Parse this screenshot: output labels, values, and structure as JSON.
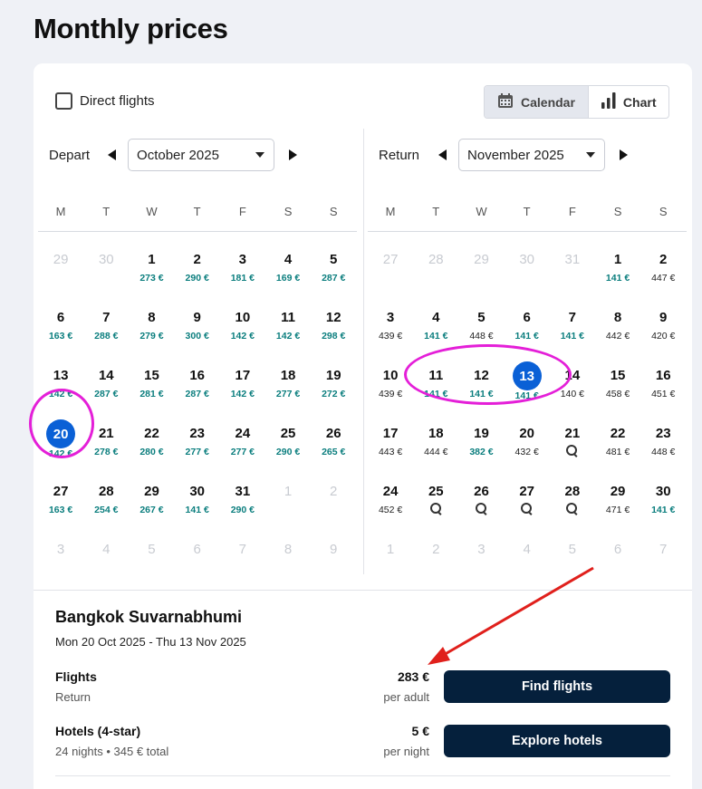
{
  "page_title": "Monthly prices",
  "filters": {
    "direct_flights_label": "Direct flights",
    "direct_flights_checked": false
  },
  "view_toggle": {
    "calendar_label": "Calendar",
    "chart_label": "Chart",
    "active": "Calendar"
  },
  "weekdays": [
    "M",
    "T",
    "W",
    "T",
    "F",
    "S",
    "S"
  ],
  "depart": {
    "label": "Depart",
    "month": "October 2025",
    "selected_day": "20",
    "days": [
      {
        "d": "29",
        "muted": true
      },
      {
        "d": "30",
        "muted": true
      },
      {
        "d": "1",
        "p": "273 €",
        "c": true
      },
      {
        "d": "2",
        "p": "290 €",
        "c": true
      },
      {
        "d": "3",
        "p": "181 €",
        "c": true
      },
      {
        "d": "4",
        "p": "169 €",
        "c": true
      },
      {
        "d": "5",
        "p": "287 €",
        "c": true
      },
      {
        "d": "6",
        "p": "163 €",
        "c": true
      },
      {
        "d": "7",
        "p": "288 €",
        "c": true
      },
      {
        "d": "8",
        "p": "279 €",
        "c": true
      },
      {
        "d": "9",
        "p": "300 €",
        "c": true
      },
      {
        "d": "10",
        "p": "142 €",
        "c": true
      },
      {
        "d": "11",
        "p": "142 €",
        "c": true
      },
      {
        "d": "12",
        "p": "298 €",
        "c": true
      },
      {
        "d": "13",
        "p": "142 €",
        "c": true
      },
      {
        "d": "14",
        "p": "287 €",
        "c": true
      },
      {
        "d": "15",
        "p": "281 €",
        "c": true
      },
      {
        "d": "16",
        "p": "287 €",
        "c": true
      },
      {
        "d": "17",
        "p": "142 €",
        "c": true
      },
      {
        "d": "18",
        "p": "277 €",
        "c": true
      },
      {
        "d": "19",
        "p": "272 €",
        "c": true
      },
      {
        "d": "20",
        "p": "142 €",
        "c": true,
        "sel": true
      },
      {
        "d": "21",
        "p": "278 €",
        "c": true
      },
      {
        "d": "22",
        "p": "280 €",
        "c": true
      },
      {
        "d": "23",
        "p": "277 €",
        "c": true
      },
      {
        "d": "24",
        "p": "277 €",
        "c": true
      },
      {
        "d": "25",
        "p": "290 €",
        "c": true
      },
      {
        "d": "26",
        "p": "265 €",
        "c": true
      },
      {
        "d": "27",
        "p": "163 €",
        "c": true
      },
      {
        "d": "28",
        "p": "254 €",
        "c": true
      },
      {
        "d": "29",
        "p": "267 €",
        "c": true
      },
      {
        "d": "30",
        "p": "141 €",
        "c": true
      },
      {
        "d": "31",
        "p": "290 €",
        "c": true
      },
      {
        "d": "1",
        "muted": true
      },
      {
        "d": "2",
        "muted": true
      },
      {
        "d": "3",
        "muted": true
      },
      {
        "d": "4",
        "muted": true
      },
      {
        "d": "5",
        "muted": true
      },
      {
        "d": "6",
        "muted": true
      },
      {
        "d": "7",
        "muted": true
      },
      {
        "d": "8",
        "muted": true
      },
      {
        "d": "9",
        "muted": true
      }
    ]
  },
  "return": {
    "label": "Return",
    "month": "November 2025",
    "selected_day": "13",
    "days": [
      {
        "d": "27",
        "muted": true
      },
      {
        "d": "28",
        "muted": true
      },
      {
        "d": "29",
        "muted": true
      },
      {
        "d": "30",
        "muted": true
      },
      {
        "d": "31",
        "muted": true
      },
      {
        "d": "1",
        "p": "141 €",
        "c": true
      },
      {
        "d": "2",
        "p": "447 €"
      },
      {
        "d": "3",
        "p": "439 €"
      },
      {
        "d": "4",
        "p": "141 €",
        "c": true
      },
      {
        "d": "5",
        "p": "448 €"
      },
      {
        "d": "6",
        "p": "141 €",
        "c": true
      },
      {
        "d": "7",
        "p": "141 €",
        "c": true
      },
      {
        "d": "8",
        "p": "442 €"
      },
      {
        "d": "9",
        "p": "420 €"
      },
      {
        "d": "10",
        "p": "439 €"
      },
      {
        "d": "11",
        "p": "141 €",
        "c": true
      },
      {
        "d": "12",
        "p": "141 €",
        "c": true
      },
      {
        "d": "13",
        "p": "141 €",
        "c": true,
        "sel": true
      },
      {
        "d": "14",
        "p": "140 €"
      },
      {
        "d": "15",
        "p": "458 €"
      },
      {
        "d": "16",
        "p": "451 €"
      },
      {
        "d": "17",
        "p": "443 €"
      },
      {
        "d": "18",
        "p": "444 €"
      },
      {
        "d": "19",
        "p": "382 €",
        "c": true
      },
      {
        "d": "20",
        "p": "432 €"
      },
      {
        "d": "21",
        "search": true
      },
      {
        "d": "22",
        "p": "481 €"
      },
      {
        "d": "23",
        "p": "448 €"
      },
      {
        "d": "24",
        "p": "452 €"
      },
      {
        "d": "25",
        "search": true
      },
      {
        "d": "26",
        "search": true
      },
      {
        "d": "27",
        "search": true
      },
      {
        "d": "28",
        "search": true
      },
      {
        "d": "29",
        "p": "471 €"
      },
      {
        "d": "30",
        "p": "141 €",
        "c": true
      },
      {
        "d": "1",
        "muted": true
      },
      {
        "d": "2",
        "muted": true
      },
      {
        "d": "3",
        "muted": true
      },
      {
        "d": "4",
        "muted": true
      },
      {
        "d": "5",
        "muted": true
      },
      {
        "d": "6",
        "muted": true
      },
      {
        "d": "7",
        "muted": true
      }
    ]
  },
  "summary": {
    "destination": "Bangkok Suvarnabhumi",
    "dates": "Mon 20 Oct 2025 - Thu 13 Nov 2025",
    "flights": {
      "label": "Flights",
      "sub": "Return",
      "price": "283 €",
      "unit": "per adult",
      "cta": "Find flights"
    },
    "hotels": {
      "label": "Hotels (4-star)",
      "sub": "24 nights • 345 € total",
      "price": "5 €",
      "unit": "per night",
      "cta": "Explore hotels"
    }
  },
  "colors": {
    "accent": "#0a60d6",
    "cta_bg": "#05203c",
    "cheap_price": "#0b7e7e",
    "annotation_ring": "#e41fd8",
    "annotation_arrow": "#e0201c"
  }
}
